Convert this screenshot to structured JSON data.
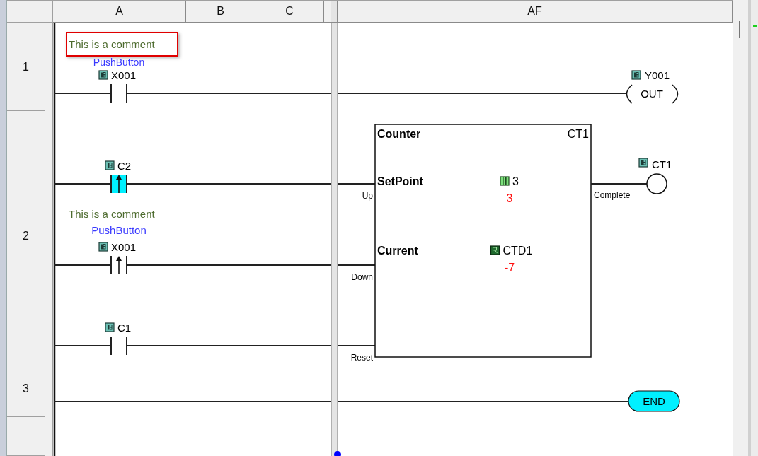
{
  "columns": [
    {
      "label": "A"
    },
    {
      "label": "B"
    },
    {
      "label": "C"
    },
    {
      "label": "AF"
    }
  ],
  "rows": [
    {
      "label": "1"
    },
    {
      "label": "2"
    },
    {
      "label": "3"
    }
  ],
  "rung_1": {
    "comment": {
      "text": "This is a comment",
      "selected": true
    },
    "contact": {
      "description": "PushButton",
      "address": "X001",
      "energized": false
    },
    "coil": {
      "address": "Y001",
      "instruction": "OUT"
    }
  },
  "rung_2": {
    "inputs": [
      {
        "address": "C2",
        "kind": "rising-edge",
        "energized": true,
        "pin": "Up"
      },
      {
        "comment": {
          "text": "This is a comment",
          "selected": false
        },
        "description": "PushButton",
        "address": "X001",
        "kind": "rising-edge",
        "energized": false,
        "pin": "Down"
      },
      {
        "address": "C1",
        "kind": "normally-open",
        "energized": false,
        "pin": "Reset"
      }
    ],
    "block": {
      "title": "Counter",
      "name": "CT1",
      "params": [
        {
          "label": "SetPoint",
          "operand": "3",
          "kind": "constant",
          "value": "3"
        },
        {
          "label": "Current",
          "operand": "CTD1",
          "kind": "register",
          "value": "-7"
        }
      ]
    },
    "output": {
      "pin": "Complete",
      "address": "CT1"
    }
  },
  "rung_3": {
    "instruction": "END"
  }
}
